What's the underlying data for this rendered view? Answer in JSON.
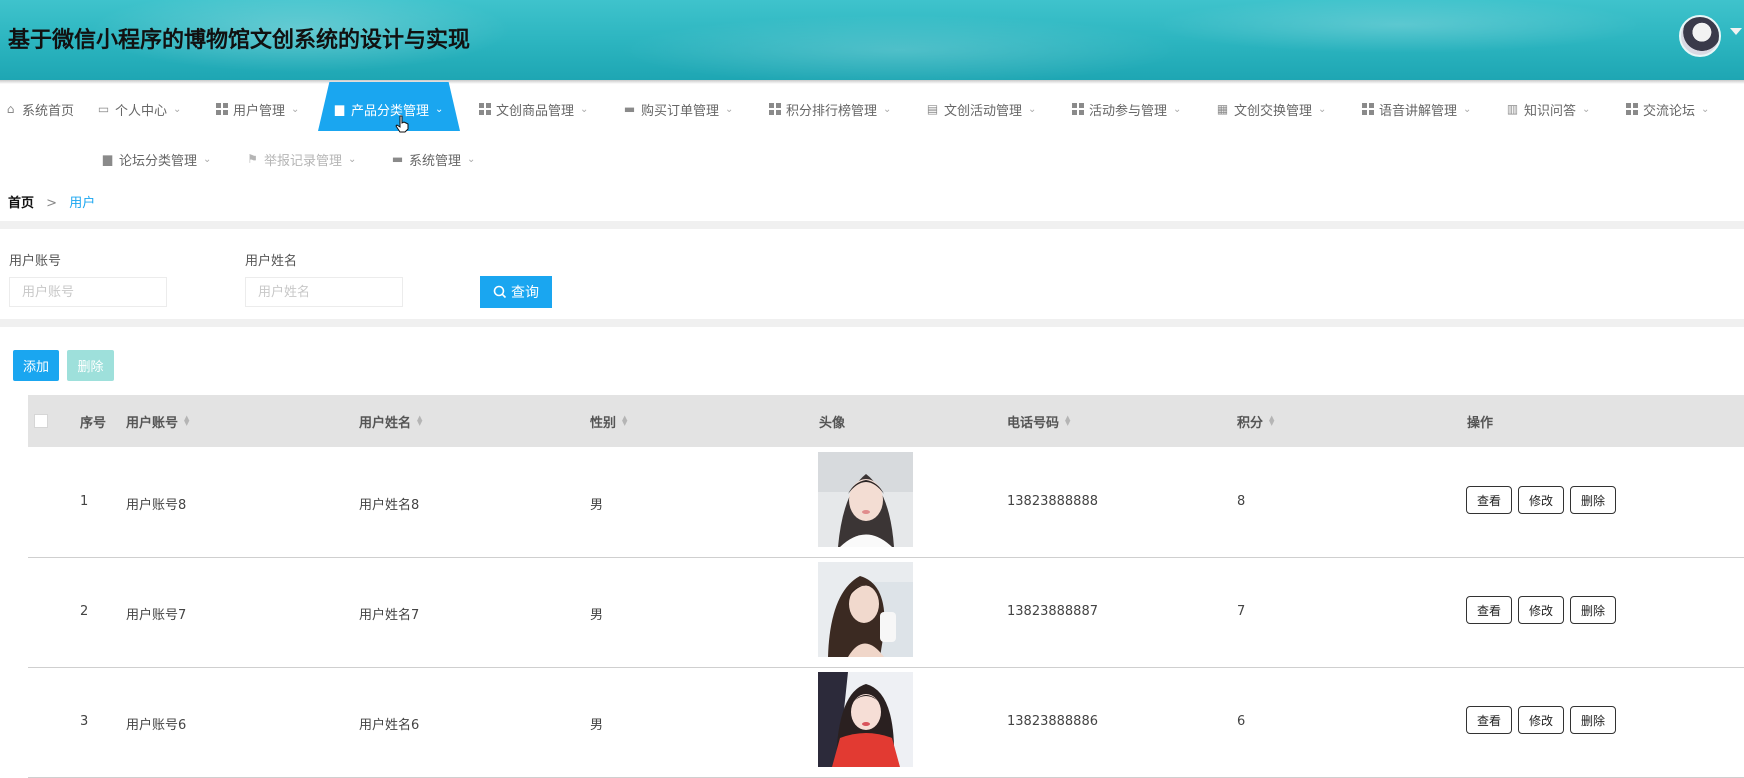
{
  "header": {
    "title": "基于微信小程序的博物馆文创系统的设计与实现"
  },
  "nav": {
    "items": [
      {
        "label": "系统首页",
        "icon": "home-icon"
      },
      {
        "label": "个人中心",
        "icon": "profile-icon"
      },
      {
        "label": "用户管理",
        "icon": "grid-icon"
      },
      {
        "label": "产品分类管理",
        "icon": "chat-icon",
        "active": true
      },
      {
        "label": "文创商品管理",
        "icon": "grid-icon"
      },
      {
        "label": "购买订单管理",
        "icon": "briefcase-icon"
      },
      {
        "label": "积分排行榜管理",
        "icon": "grid-icon"
      },
      {
        "label": "文创活动管理",
        "icon": "clipboard-icon"
      },
      {
        "label": "活动参与管理",
        "icon": "grid-icon"
      },
      {
        "label": "文创交换管理",
        "icon": "apps-icon"
      },
      {
        "label": "语音讲解管理",
        "icon": "grid-icon"
      },
      {
        "label": "知识问答",
        "icon": "book-icon"
      },
      {
        "label": "交流论坛",
        "icon": "grid-icon"
      },
      {
        "label": "论坛分类管理",
        "icon": "monitor-icon"
      },
      {
        "label": "举报记录管理",
        "icon": "flag-icon"
      },
      {
        "label": "系统管理",
        "icon": "briefcase-icon"
      }
    ]
  },
  "breadcrumb": {
    "home": "首页",
    "separator": ">",
    "current": "用户"
  },
  "search": {
    "account_label": "用户账号",
    "account_placeholder": "用户账号",
    "name_label": "用户姓名",
    "name_placeholder": "用户姓名",
    "button_label": "查询"
  },
  "actions": {
    "add_label": "添加",
    "delete_label": "删除"
  },
  "table": {
    "columns": [
      "序号",
      "用户账号",
      "用户姓名",
      "性别",
      "头像",
      "电话号码",
      "积分",
      "操作"
    ],
    "rows": [
      {
        "index": "1",
        "account": "用户账号8",
        "name": "用户姓名8",
        "gender": "男",
        "phone": "13823888888",
        "points": "8"
      },
      {
        "index": "2",
        "account": "用户账号7",
        "name": "用户姓名7",
        "gender": "男",
        "phone": "13823888887",
        "points": "7"
      },
      {
        "index": "3",
        "account": "用户账号6",
        "name": "用户姓名6",
        "gender": "男",
        "phone": "13823888886",
        "points": "6"
      }
    ],
    "row_actions": {
      "view": "查看",
      "edit": "修改",
      "delete": "删除"
    }
  },
  "colors": {
    "accent": "#1aa6f0",
    "delete_disabled": "#9ee0db",
    "header_bg": "#2bb4bf"
  }
}
